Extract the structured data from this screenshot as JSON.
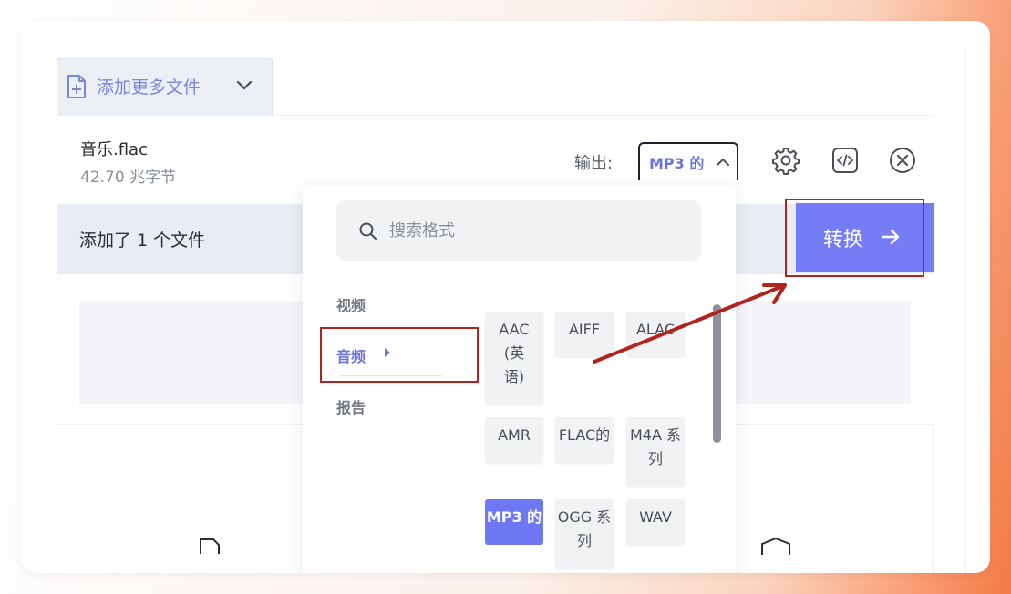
{
  "toolbar": {
    "add_more_label": "添加更多文件"
  },
  "file": {
    "name": "音乐.flac",
    "size": "42.70 兆字节",
    "output_label": "输出:",
    "format_value": "MP3 的"
  },
  "status": {
    "text": "添加了 1 个文件",
    "convert_label": "转换"
  },
  "dropdown": {
    "search_placeholder": "搜索格式",
    "categories": {
      "video": "视频",
      "audio": "音频",
      "report": "报告"
    },
    "formats": [
      "AAC (英语)",
      "AIFF",
      "ALAC",
      "AMR",
      "FLAC的",
      "M4A 系列",
      "MP3 的",
      "OGG 系列",
      "WAV"
    ],
    "selected_format": "MP3 的"
  },
  "colors": {
    "accent": "#747df5",
    "annotation_red": "#b3231d",
    "status_bg": "#e9ecf3"
  },
  "icons": [
    "file-plus-icon",
    "chevron-down-icon",
    "chevron-up-icon",
    "gear-icon",
    "code-icon",
    "close-circle-icon",
    "arrow-right-icon",
    "search-icon",
    "caret-right-icon"
  ]
}
